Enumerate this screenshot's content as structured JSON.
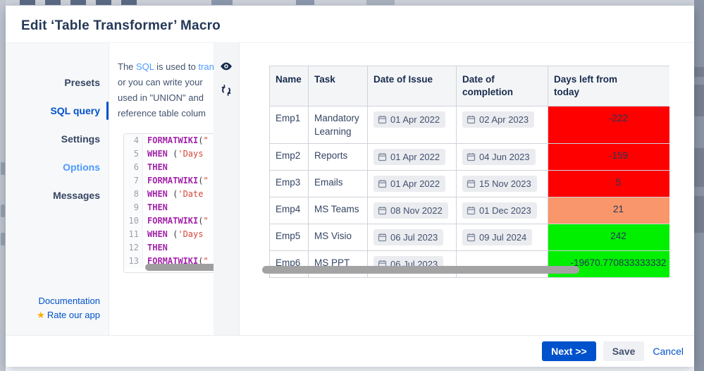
{
  "dialog": {
    "title": "Edit ‘Table Transformer’ Macro"
  },
  "sidebar": {
    "items": [
      {
        "label": "Presets",
        "state": "normal"
      },
      {
        "label": "SQL query",
        "state": "active"
      },
      {
        "label": "Settings",
        "state": "normal"
      },
      {
        "label": "Options",
        "state": "visited"
      },
      {
        "label": "Messages",
        "state": "normal"
      }
    ],
    "documentation_label": "Documentation",
    "rate_label": "Rate our app",
    "star_icon": "star-icon"
  },
  "sql_panel": {
    "description_lines": [
      [
        {
          "t": "The "
        },
        {
          "t": "SQL",
          "link": true
        },
        {
          "t": " is used to "
        },
        {
          "t": "transform",
          "link": true
        }
      ],
      [
        {
          "t": "or you can write your"
        }
      ],
      [
        {
          "t": "used in \"UNION\" and"
        }
      ],
      [
        {
          "t": "reference table colum"
        }
      ]
    ],
    "code_lines": [
      {
        "num": 4,
        "tokens": [
          {
            "c": "kw",
            "v": "FORMATWIKI"
          },
          {
            "c": "p",
            "v": "("
          },
          {
            "c": "str",
            "v": "\""
          }
        ]
      },
      {
        "num": 5,
        "tokens": [
          {
            "c": "kw",
            "v": "WHEN"
          },
          {
            "c": "p",
            "v": " ("
          },
          {
            "c": "str",
            "v": "'Days"
          }
        ]
      },
      {
        "num": 6,
        "tokens": [
          {
            "c": "kw",
            "v": "THEN"
          }
        ]
      },
      {
        "num": 7,
        "tokens": [
          {
            "c": "kw",
            "v": "FORMATWIKI"
          },
          {
            "c": "p",
            "v": "("
          },
          {
            "c": "str",
            "v": "\""
          }
        ]
      },
      {
        "num": 8,
        "tokens": [
          {
            "c": "kw",
            "v": "WHEN"
          },
          {
            "c": "p",
            "v": " ("
          },
          {
            "c": "str",
            "v": "'Date"
          }
        ]
      },
      {
        "num": 9,
        "tokens": [
          {
            "c": "kw",
            "v": "THEN"
          }
        ]
      },
      {
        "num": 10,
        "tokens": [
          {
            "c": "kw",
            "v": "FORMATWIKI"
          },
          {
            "c": "p",
            "v": "("
          },
          {
            "c": "str",
            "v": "\""
          }
        ]
      },
      {
        "num": 11,
        "tokens": [
          {
            "c": "kw",
            "v": "WHEN"
          },
          {
            "c": "p",
            "v": " ("
          },
          {
            "c": "str",
            "v": "'Days"
          }
        ]
      },
      {
        "num": 12,
        "tokens": [
          {
            "c": "kw",
            "v": "THEN"
          }
        ]
      },
      {
        "num": 13,
        "tokens": [
          {
            "c": "kw",
            "v": "FORMATWIKI"
          },
          {
            "c": "p",
            "v": "("
          },
          {
            "c": "str",
            "v": "\""
          }
        ]
      }
    ]
  },
  "toolbar": {
    "icons": [
      "eye-icon",
      "refresh-icon"
    ]
  },
  "table": {
    "columns": [
      "Name",
      "Task",
      "Date of Issue",
      "Date of completion",
      "Days left from today"
    ],
    "rows": [
      {
        "name": "Emp1",
        "task": "Mandatory Learning",
        "issue": "01 Apr 2022",
        "completion": "02 Apr 2023",
        "days": "-222",
        "days_color": "#ff0000"
      },
      {
        "name": "Emp2",
        "task": "Reports",
        "issue": "01 Apr 2022",
        "completion": "04 Jun 2023",
        "days": "-159",
        "days_color": "#ff0000"
      },
      {
        "name": "Emp3",
        "task": "Emails",
        "issue": "01 Apr 2022",
        "completion": "15 Nov 2023",
        "days": "5",
        "days_color": "#ff0000"
      },
      {
        "name": "Emp4",
        "task": "MS Teams",
        "issue": "08 Nov 2022",
        "completion": "01 Dec 2023",
        "days": "21",
        "days_color": "#f9966b"
      },
      {
        "name": "Emp5",
        "task": "MS Visio",
        "issue": "06 Jul 2023",
        "completion": "09 Jul 2024",
        "days": "242",
        "days_color": "#00f000"
      },
      {
        "name": "Emp6",
        "task": "MS PPT",
        "issue": "06 Jul 2023",
        "completion": "",
        "days": "-19670.770833333332",
        "days_color": "#00f000"
      }
    ]
  },
  "footer": {
    "next_label": "Next >>",
    "save_label": "Save",
    "cancel_label": "Cancel"
  },
  "colors": {
    "accent": "#0052cc",
    "negative": "#ff0000",
    "warning": "#f9966b",
    "positive": "#00f000",
    "star": "#ffab00"
  }
}
